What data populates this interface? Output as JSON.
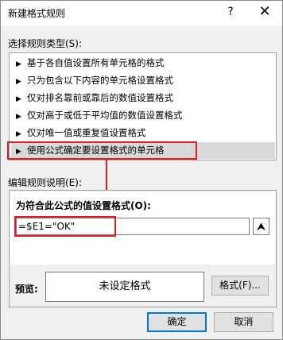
{
  "window": {
    "title": "新建格式规则",
    "help_glyph": "?",
    "close_glyph": "✕"
  },
  "rule_type": {
    "label": "选择规则类型(S):",
    "items": [
      "基于各自值设置所有单元格的格式",
      "只为包含以下内容的单元格设置格式",
      "仅对排名靠前或靠后的数值设置格式",
      "仅对高于或低于平均值的数值设置格式",
      "仅对唯一值或重复值设置格式",
      "使用公式确定要设置格式的单元格"
    ],
    "selected_index": 5,
    "arrow_glyph": "▶"
  },
  "rule_description": {
    "label": "编辑规则说明(E):",
    "formula_label": "为符合此公式的值设置格式(O):",
    "formula_value": "=$E1=\"OK\"",
    "collapse_glyph": "⮝"
  },
  "preview": {
    "label": "预览:",
    "text": "未设定格式",
    "format_button": "格式(F)..."
  },
  "buttons": {
    "ok": "确定",
    "cancel": "取消"
  },
  "colors": {
    "highlight": "#e01e25",
    "selected_row": "#d9d9d9",
    "default_button_border": "#0078d7"
  }
}
